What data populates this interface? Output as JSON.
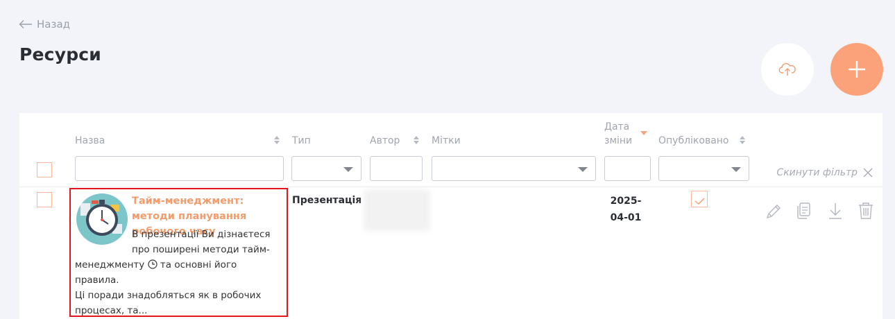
{
  "nav": {
    "back_label": "Назад"
  },
  "page": {
    "title": "Ресурси"
  },
  "toolbar": {
    "upload_icon": "cloud-upload-icon",
    "add_icon": "plus-icon"
  },
  "colors": {
    "accent": "#fca27a",
    "title_orange": "#f39c6b",
    "highlight_border": "#e0151d"
  },
  "table": {
    "columns": {
      "name": "Назва",
      "type": "Тип",
      "author": "Автор",
      "tags": "Мітки",
      "date_line1": "Дата",
      "date_line2": "зміни",
      "published": "Опубліковано"
    },
    "reset_filter_label": "Скинути фільтр",
    "rows": [
      {
        "title": "Тайм-менеджмент: методи планування робочого часу",
        "desc1": "В презентації Ви дізнаєтеся про поширені методи тайм-",
        "desc2a": "менеджменту",
        "desc2b": "та основні його правила.",
        "desc3": "Ці поради знадобляться як в робочих процесах, та...",
        "type": "Презентація",
        "date_line1": "2025-",
        "date_line2": "04-01",
        "published": true
      }
    ]
  }
}
